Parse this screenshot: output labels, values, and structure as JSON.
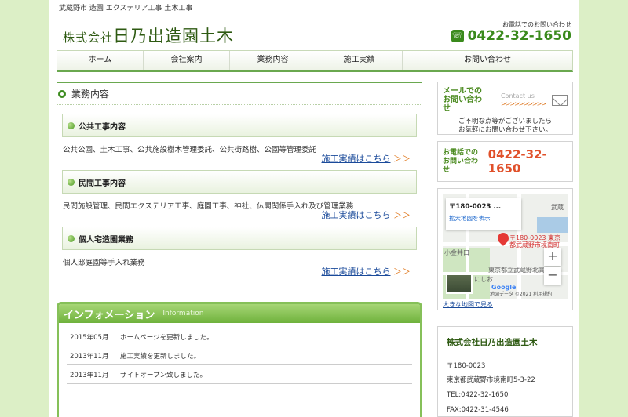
{
  "header": {
    "tagline": "武蔵野市 造園 エクステリア工事 土木工事",
    "logo_prefix": "株式会社",
    "logo_name": "日乃出造園土木",
    "tel_note": "お電話でのお問い合わせ",
    "tel_number": "0422-32-1650"
  },
  "nav": [
    {
      "label": "ホーム"
    },
    {
      "label": "会社案内"
    },
    {
      "label": "業務内容"
    },
    {
      "label": "施工実績"
    },
    {
      "label": "お問い合わせ"
    }
  ],
  "main": {
    "title": "業務内容",
    "sections": [
      {
        "heading": "公共工事内容",
        "text": "公共公園、土木工事、公共施設樹木管理委託、公共街路樹、公園等管理委託",
        "link": "施工実績はこちら",
        "arrow": "＞＞"
      },
      {
        "heading": "民間工事内容",
        "text": "民間施設管理、民間エクステリア工事、庭園工事、神社、仏閣関係手入れ及び管理業務",
        "link": "施工実績はこちら",
        "arrow": "＞＞"
      },
      {
        "heading": "個人宅造園業務",
        "text": "個人邸庭園等手入れ業務",
        "link": "施工実績はこちら",
        "arrow": "＞＞"
      }
    ]
  },
  "info": {
    "title": "インフォメーション",
    "subtitle": "Information",
    "rows": [
      {
        "date": "2015年05月",
        "text": "ホームページを更新しました。"
      },
      {
        "date": "2013年11月",
        "text": "施工実績を更新しました。"
      },
      {
        "date": "2013年11月",
        "text": "サイトオープン致しました。"
      }
    ]
  },
  "sidebar": {
    "mail_label_1": "メールでの",
    "mail_label_2": "お問い合わせ",
    "contact_us": "Contact us",
    "contact_arrows": ">>>>>>>>>>",
    "mail_desc_1": "ご不明な点等がございましたら",
    "mail_desc_2": "お気軽にお問い合わせ下さい。",
    "tel_label_1": "お電話での",
    "tel_label_2": "お問い合わせ",
    "tel_number": "0422-32-1650",
    "map": {
      "popup_title": "〒180-0023 ...",
      "popup_link": "拡大地図を表示",
      "pin_label_1": "〒180-0023 東京",
      "pin_label_2": "都武蔵野市境南町",
      "zoom_in": "+",
      "zoom_out": "−",
      "brand": "Google",
      "footer": "地図データ ©2021 利用規約",
      "place_1": "武蔵",
      "place_2": "小金井口",
      "place_3": "にしお",
      "place_4": "東京都立武蔵野北高",
      "large_map_link": "大きな地図で見る"
    },
    "company": {
      "name": "株式会社日乃出造園土木",
      "zip": "〒180-0023",
      "address": "東京都武蔵野市境南町5-3-22",
      "tel": "TEL:0422-32-1650",
      "fax": "FAX:0422-31-4546"
    }
  },
  "colors": {
    "accent_green": "#6aa84f",
    "logo_green": "#2e5a12",
    "link_blue": "#1a4a9a",
    "tel_orange": "#e0502a"
  }
}
